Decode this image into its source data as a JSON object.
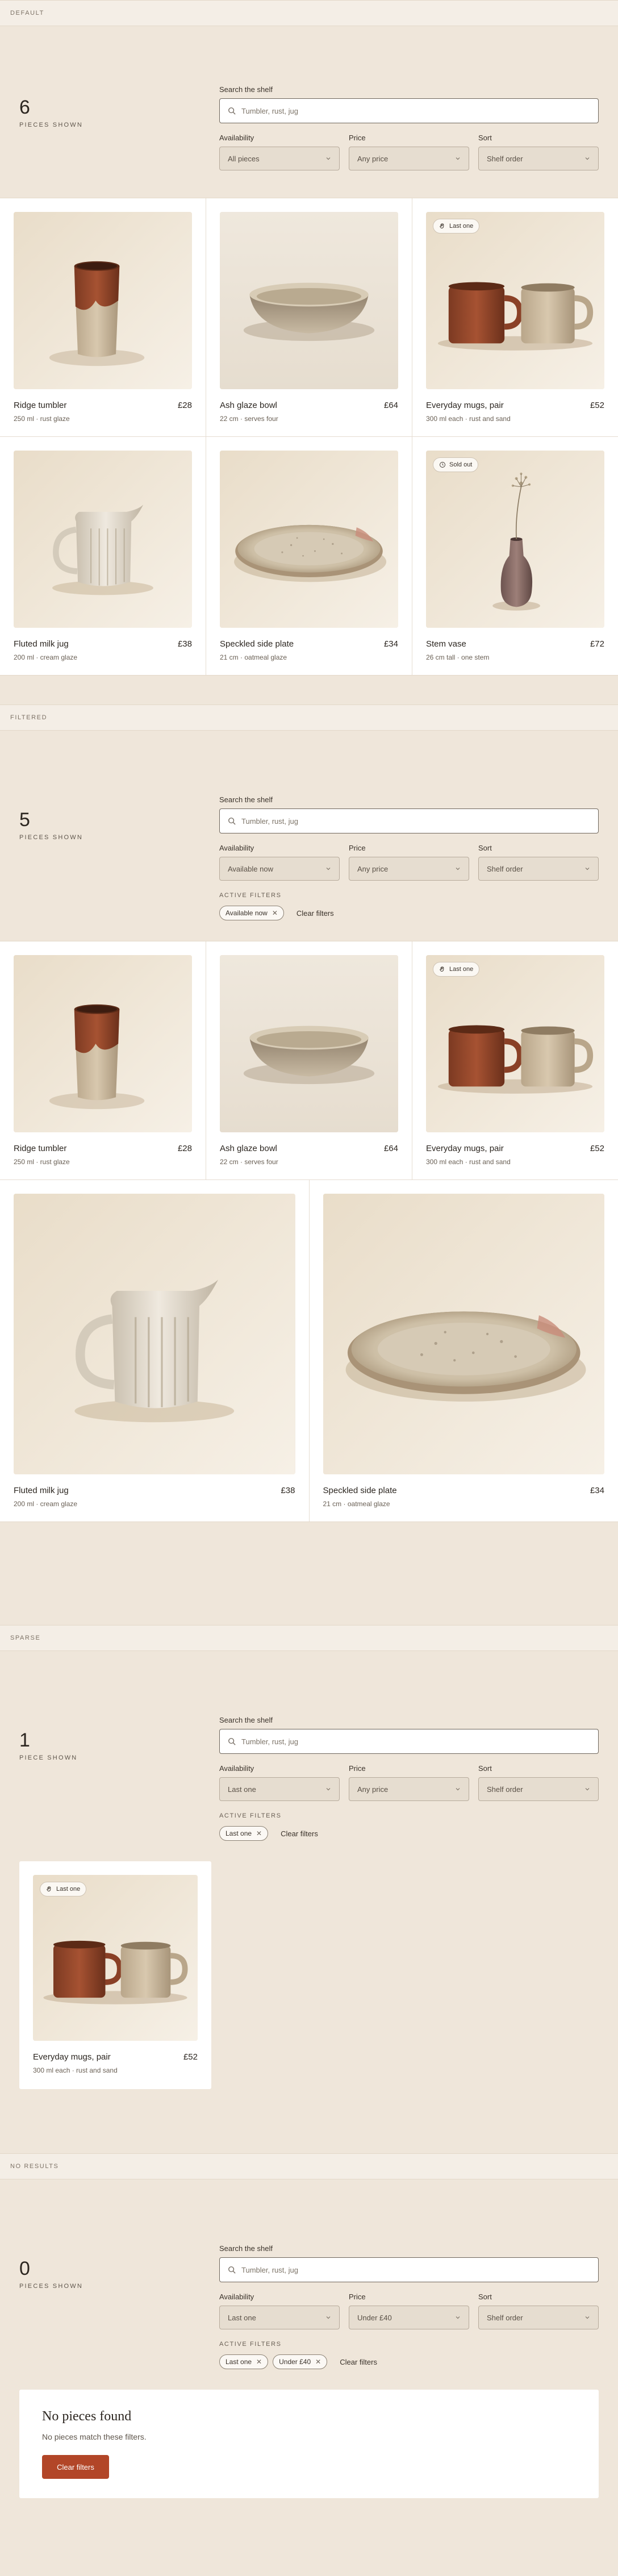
{
  "search": {
    "label": "Search the shelf",
    "placeholder": "Tumbler, rust, jug"
  },
  "labels": {
    "availability": "Availability",
    "price": "Price",
    "sort": "Sort",
    "active_filters": "ACTIVE FILTERS",
    "clear_filters": "Clear filters",
    "pieces_shown": "PIECES SHOWN",
    "piece_shown": "PIECE SHOWN"
  },
  "products": {
    "ridge": {
      "name": "Ridge tumbler",
      "price": "£28",
      "sub": "250 ml · rust glaze"
    },
    "bowl": {
      "name": "Ash glaze bowl",
      "price": "£64",
      "sub": "22 cm · serves four"
    },
    "mugs": {
      "name": "Everyday mugs, pair",
      "price": "£52",
      "sub": "300 ml each · rust and sand",
      "badge": "Last one"
    },
    "jug": {
      "name": "Fluted milk jug",
      "price": "£38",
      "sub": "200 ml · cream glaze"
    },
    "plate": {
      "name": "Speckled side plate",
      "price": "£34",
      "sub": "21 cm · oatmeal glaze"
    },
    "vase": {
      "name": "Stem vase",
      "price": "£72",
      "sub": "26 cm tall · one stem",
      "badge": "Sold out"
    }
  },
  "sections": {
    "default": {
      "title": "DEFAULT",
      "count": "6",
      "availability": "All pieces",
      "price": "Any price",
      "sort": "Shelf order"
    },
    "filtered": {
      "title": "FILTERED",
      "count": "5",
      "availability": "Available now",
      "price": "Any price",
      "sort": "Shelf order",
      "chip1": "Available now"
    },
    "sparse": {
      "title": "SPARSE",
      "count": "1",
      "availability": "Last one",
      "price": "Any price",
      "sort": "Shelf order",
      "chip1": "Last one"
    },
    "noresults": {
      "title": "NO RESULTS",
      "count": "0",
      "availability": "Last one",
      "price": "Under £40",
      "sort": "Shelf order",
      "chip1": "Last one",
      "chip2": "Under £40",
      "empty_title": "No pieces found",
      "empty_sub": "No pieces match these filters.",
      "empty_button": "Clear filters"
    }
  },
  "colors": {
    "accent": "#b24628",
    "background": "#efe6da",
    "card": "#ffffff"
  }
}
